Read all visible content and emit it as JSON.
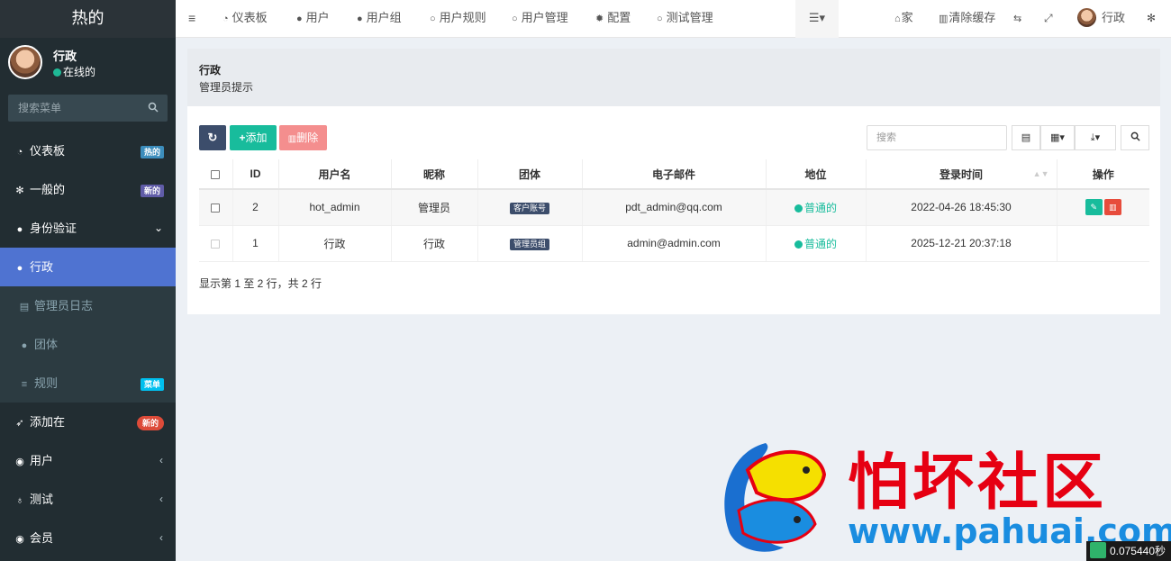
{
  "sidebar": {
    "logo": "热的",
    "user": {
      "name": "行政",
      "status": "在线的"
    },
    "search_placeholder": "搜索菜单",
    "items": [
      {
        "label": "仪表板",
        "icon": "dashboard-icon",
        "badge": "热的",
        "badge_color": "#3c8dbc"
      },
      {
        "label": "一般的",
        "icon": "cogs-icon",
        "badge": "新的",
        "badge_color": "#605ca8"
      },
      {
        "label": "身份验证",
        "icon": "users-icon"
      },
      {
        "label": "行政",
        "icon": "user-icon"
      },
      {
        "label": "管理员日志",
        "icon": "list-alt-icon"
      },
      {
        "label": "团体",
        "icon": "group-icon"
      },
      {
        "label": "规则",
        "icon": "bars-icon",
        "badge": "菜单",
        "badge_color": "#00c0ef"
      },
      {
        "label": "添加在",
        "icon": "rocket-icon",
        "badge": "新的",
        "badge_color": "#dd4b39"
      },
      {
        "label": "用户",
        "icon": "user-circle-icon"
      },
      {
        "label": "测试",
        "icon": "flask-icon"
      },
      {
        "label": "会员",
        "icon": "user-circle-icon"
      }
    ]
  },
  "topbar": {
    "menu": [
      "仪表板",
      "用户",
      "用户组",
      "用户规则",
      "用户管理",
      "配置",
      "测试管理"
    ],
    "home": "家",
    "clear_cache": "清除缓存",
    "user": "行政"
  },
  "header": {
    "title": "行政",
    "subtitle": "管理员提示"
  },
  "toolbar": {
    "add": "添加",
    "delete": "删除",
    "search_placeholder": "搜索"
  },
  "table": {
    "columns": [
      "ID",
      "用户名",
      "昵称",
      "团体",
      "电子邮件",
      "地位",
      "登录时间",
      "操作"
    ],
    "rows": [
      {
        "id": "2",
        "username": "hot_admin",
        "nickname": "管理员",
        "group": "客户账号",
        "email": "pdt_admin@qq.com",
        "status": "普通的",
        "login_time": "2022-04-26 18:45:30"
      },
      {
        "id": "1",
        "username": "行政",
        "nickname": "行政",
        "group": "管理员组",
        "email": "admin@admin.com",
        "status": "普通的",
        "login_time": "2025-12-21 20:37:18"
      }
    ]
  },
  "pager": "显示第 1 至 2 行，共 2 行",
  "watermark": {
    "title": "怕坏社区",
    "url": "www.pahuai.com"
  },
  "timer": "0.075440秒",
  "colors": {
    "sidebar": "#222d32",
    "active": "#4f73d1",
    "success": "#18bc9c",
    "danger": "#e74c3c"
  }
}
